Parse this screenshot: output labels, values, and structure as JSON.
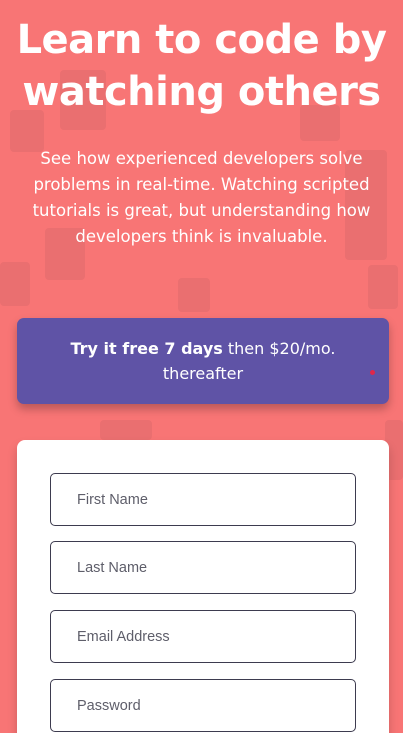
{
  "hero": {
    "title_line1": "Learn to code by",
    "title_line2": "watching others",
    "subtitle": "See how experienced developers solve problems in real-time. Watching scripted tutorials is great, but understanding how developers think is invaluable."
  },
  "trial": {
    "bold": "Try it free 7 days",
    "rest": " then $20/mo. thereafter"
  },
  "form": {
    "first_name_placeholder": "First Name",
    "last_name_placeholder": "Last Name",
    "email_placeholder": "Email Address",
    "password_placeholder": "Password"
  },
  "colors": {
    "background": "#f87575",
    "banner": "#5f53a6",
    "card": "#ffffff",
    "field_border": "#3d3b4f"
  }
}
